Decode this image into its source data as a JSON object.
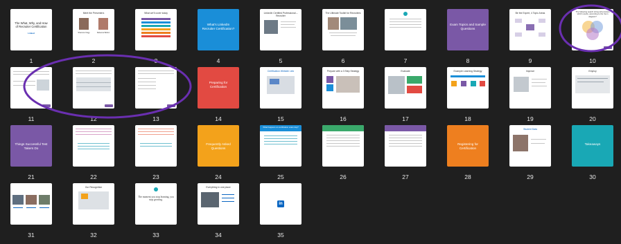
{
  "slides": [
    {
      "num": "1",
      "title": "The What, Why, and How of Recruiter Certification",
      "logo": "Linked"
    },
    {
      "num": "2",
      "title": "Meet the Presenters",
      "p1": "Shannon Nagy",
      "p2": "Rebecca Bolton"
    },
    {
      "num": "3",
      "title": "What we'll cover today"
    },
    {
      "num": "4",
      "title": "What's LinkedIn Recruiter Certification?"
    },
    {
      "num": "5",
      "title": "LinkedIn Certified Professional – Recruiter"
    },
    {
      "num": "6",
      "title": "The Ultimate Toolkit for Recruiters"
    },
    {
      "num": "7",
      "title": ""
    },
    {
      "num": "8",
      "title": "Exam Topics and Sample Questions"
    },
    {
      "num": "9",
      "title": "Be the Expert, 4 Topic Areas"
    },
    {
      "num": "10",
      "title": "The following search string will produce which results, according to the Venn diagram?"
    },
    {
      "num": "11",
      "title": ""
    },
    {
      "num": "12",
      "title": ""
    },
    {
      "num": "13",
      "title": ""
    },
    {
      "num": "14",
      "title": "Preparing for Certification"
    },
    {
      "num": "15",
      "title": "Certification Website Link"
    },
    {
      "num": "16",
      "title": "Prepare with a 3 Step Strategy"
    },
    {
      "num": "17",
      "title": "Evaluate"
    },
    {
      "num": "18",
      "title": "Example Learning Strategy"
    },
    {
      "num": "19",
      "title": "Improve"
    },
    {
      "num": "20",
      "title": "Employ"
    },
    {
      "num": "21",
      "title": "Things Successful Test Takers Do"
    },
    {
      "num": "22",
      "title": ""
    },
    {
      "num": "23",
      "title": ""
    },
    {
      "num": "24",
      "title": "Frequently Asked Questions"
    },
    {
      "num": "25",
      "title": "What happens on certification exam day?"
    },
    {
      "num": "26",
      "title": ""
    },
    {
      "num": "27",
      "title": ""
    },
    {
      "num": "28",
      "title": "Registering for Certification"
    },
    {
      "num": "29",
      "title": "Student Data"
    },
    {
      "num": "30",
      "title": "Takeaways"
    },
    {
      "num": "31",
      "title": ""
    },
    {
      "num": "32",
      "title": "Our Recognition"
    },
    {
      "num": "33",
      "title": "The moment you stop learning, you stop growing."
    },
    {
      "num": "34",
      "title": "Everything in one place"
    },
    {
      "num": "35",
      "title": "in"
    }
  ],
  "colors": {
    "purple": "#7a58a6",
    "blue": "#1a8ed8",
    "red": "#e24a42",
    "orange": "#f3a21b",
    "teal": "#19a8b5",
    "deep_orange": "#ee7f1f",
    "linkedin": "#0a66c2",
    "annotation": "#6a2fb0"
  }
}
